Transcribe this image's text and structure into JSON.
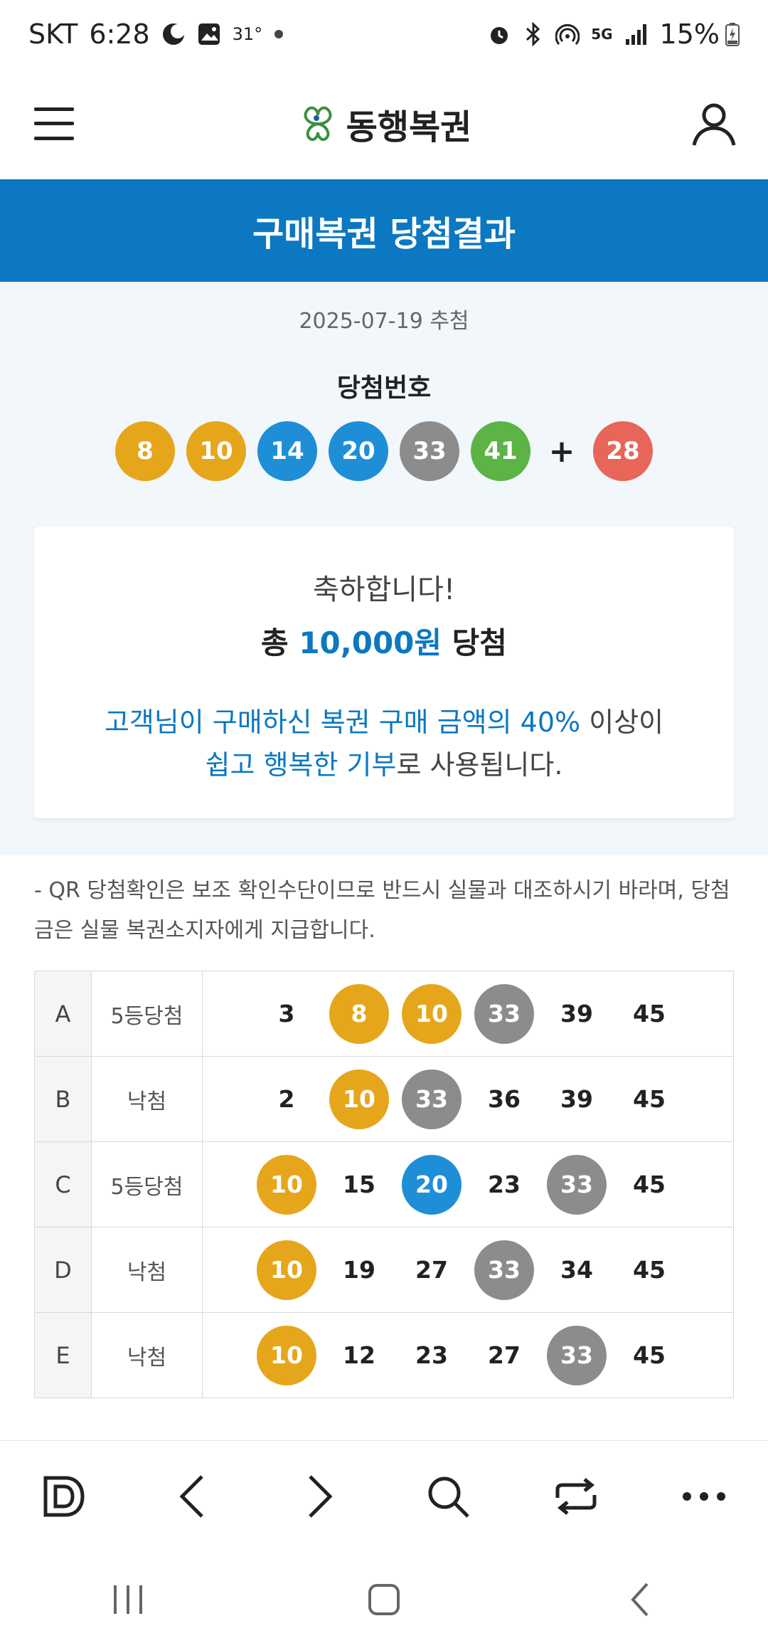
{
  "status_bar": {
    "carrier": "SKT",
    "time": "6:28",
    "temperature": "31°",
    "network": "5G",
    "battery": "15%"
  },
  "header": {
    "logo_text": "동행복권"
  },
  "title": "구매복권 당첨결과",
  "draw": {
    "date": "2025-07-19 추첨",
    "label": "당첨번호",
    "numbers": [
      {
        "value": "8",
        "color": "#e6a61c"
      },
      {
        "value": "10",
        "color": "#e6a61c"
      },
      {
        "value": "14",
        "color": "#1e8fd6"
      },
      {
        "value": "20",
        "color": "#1e8fd6"
      },
      {
        "value": "33",
        "color": "#8c8c8c"
      },
      {
        "value": "41",
        "color": "#5bb445"
      }
    ],
    "plus": "+",
    "bonus": {
      "value": "28",
      "color": "#e86559"
    }
  },
  "result": {
    "congrats": "축하합니다!",
    "total_prefix": "총",
    "total_amount": "10,000원",
    "total_suffix": "당첨",
    "donation_line1_hl": "고객님이 구매하신 복권 구매 금액의 40%",
    "donation_line1_rest": "이상이",
    "donation_line2_hl": "쉽고 행복한 기부",
    "donation_line2_rest": "로 사용됩니다."
  },
  "notice": "- QR 당첨확인은 보조 확인수단이므로 반드시 실물과 대조하시기 바라며, 당첨금은 실물 복권소지자에게 지급합니다.",
  "colors": {
    "yellow": "#e6a61c",
    "blue": "#1e8fd6",
    "gray": "#8c8c8c",
    "brand_blue": "#0b78c1"
  },
  "tickets": [
    {
      "game": "A",
      "result": "5등당첨",
      "numbers": [
        {
          "n": "3",
          "c": ""
        },
        {
          "n": "8",
          "c": "#e6a61c"
        },
        {
          "n": "10",
          "c": "#e6a61c"
        },
        {
          "n": "33",
          "c": "#8c8c8c"
        },
        {
          "n": "39",
          "c": ""
        },
        {
          "n": "45",
          "c": ""
        }
      ]
    },
    {
      "game": "B",
      "result": "낙첨",
      "numbers": [
        {
          "n": "2",
          "c": ""
        },
        {
          "n": "10",
          "c": "#e6a61c"
        },
        {
          "n": "33",
          "c": "#8c8c8c"
        },
        {
          "n": "36",
          "c": ""
        },
        {
          "n": "39",
          "c": ""
        },
        {
          "n": "45",
          "c": ""
        }
      ]
    },
    {
      "game": "C",
      "result": "5등당첨",
      "numbers": [
        {
          "n": "10",
          "c": "#e6a61c"
        },
        {
          "n": "15",
          "c": ""
        },
        {
          "n": "20",
          "c": "#1e8fd6"
        },
        {
          "n": "23",
          "c": ""
        },
        {
          "n": "33",
          "c": "#8c8c8c"
        },
        {
          "n": "45",
          "c": ""
        }
      ]
    },
    {
      "game": "D",
      "result": "낙첨",
      "numbers": [
        {
          "n": "10",
          "c": "#e6a61c"
        },
        {
          "n": "19",
          "c": ""
        },
        {
          "n": "27",
          "c": ""
        },
        {
          "n": "33",
          "c": "#8c8c8c"
        },
        {
          "n": "34",
          "c": ""
        },
        {
          "n": "45",
          "c": ""
        }
      ]
    },
    {
      "game": "E",
      "result": "낙첨",
      "numbers": [
        {
          "n": "10",
          "c": "#e6a61c"
        },
        {
          "n": "12",
          "c": ""
        },
        {
          "n": "23",
          "c": ""
        },
        {
          "n": "27",
          "c": ""
        },
        {
          "n": "33",
          "c": "#8c8c8c"
        },
        {
          "n": "45",
          "c": ""
        }
      ]
    }
  ],
  "toolbar_icons": [
    "home-d-icon",
    "back-arrow-icon",
    "forward-arrow-icon",
    "search-icon",
    "tabs-switch-icon",
    "more-icon"
  ],
  "nav_icons": [
    "recent-apps-icon",
    "home-icon",
    "back-icon"
  ]
}
